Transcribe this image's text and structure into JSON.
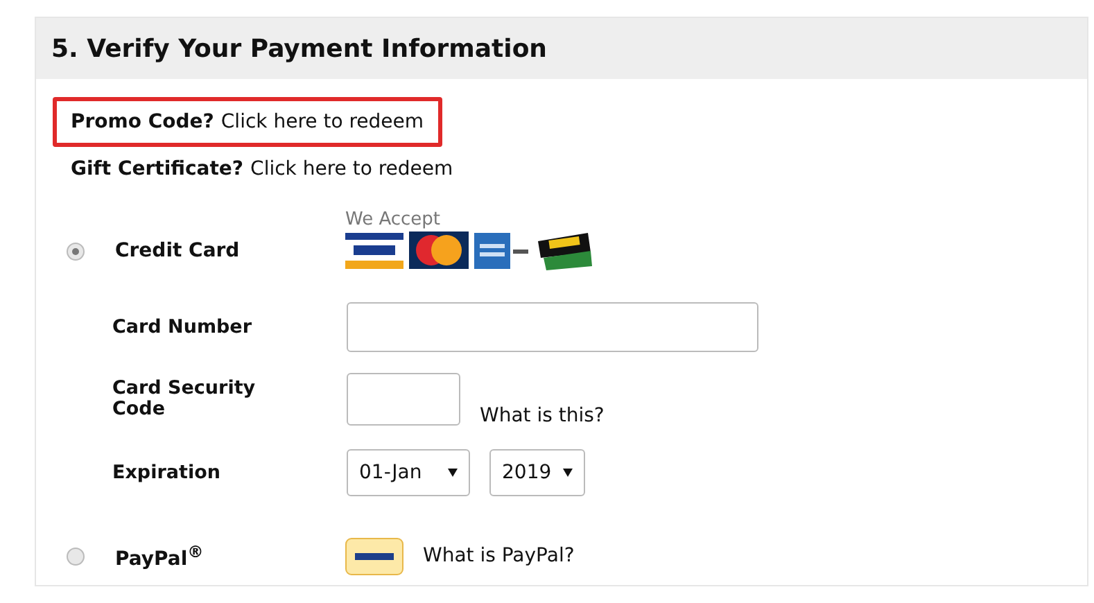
{
  "section": {
    "title": "5. Verify Your Payment Information"
  },
  "redeem_links": [
    {
      "prompt": "Promo Code?",
      "link": "Click here to redeem",
      "highlighted": true
    },
    {
      "prompt": "Gift Certificate?",
      "link": "Click here to redeem",
      "highlighted": false
    }
  ],
  "payment_methods": [
    {
      "kind": "card",
      "label": "Credit Card",
      "selected": true,
      "accept_label": "We Accept"
    },
    {
      "kind": "paypal",
      "label": "PayPal$^{®}$",
      "selected": false,
      "help_link": "What is PayPal?"
    }
  ],
  "card_fields": [
    {
      "kind": "text",
      "label": "Card Number"
    },
    {
      "kind": "cvv",
      "label": "Card Security Code",
      "help_link": "What is this?"
    },
    {
      "kind": "expiry",
      "label": "Expiration",
      "month": "01-Jan",
      "year": "2019"
    }
  ]
}
